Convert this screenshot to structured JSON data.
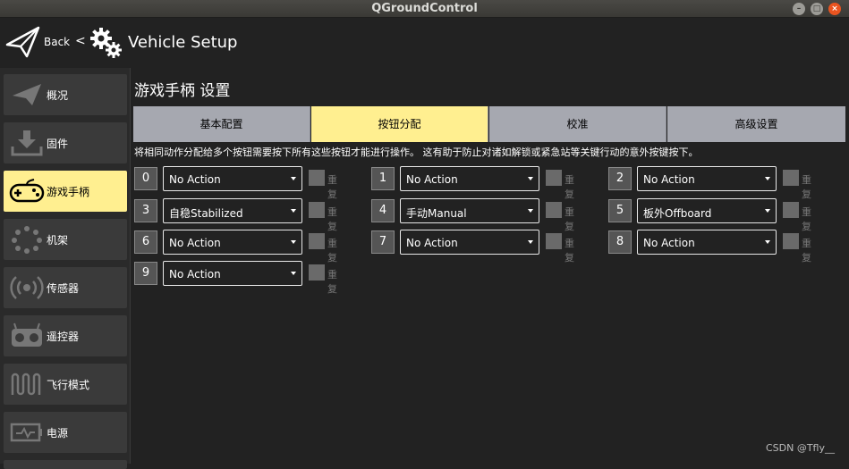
{
  "window": {
    "title": "QGroundControl",
    "min": "–",
    "max": "□",
    "close": "×"
  },
  "header": {
    "back_label": "Back",
    "chevron": "<",
    "title": "Vehicle Setup"
  },
  "sidebar": {
    "items": [
      {
        "label": "概况",
        "icon": "plane-icon"
      },
      {
        "label": "固件",
        "icon": "download-icon"
      },
      {
        "label": "游戏手柄",
        "icon": "gamepad-icon",
        "active": true
      },
      {
        "label": "机架",
        "icon": "dots-circle-icon"
      },
      {
        "label": "传感器",
        "icon": "radio-waves-icon"
      },
      {
        "label": "遥控器",
        "icon": "rc-transmitter-icon"
      },
      {
        "label": "飞行模式",
        "icon": "wave-icon"
      },
      {
        "label": "电源",
        "icon": "battery-icon"
      }
    ]
  },
  "content": {
    "title": "游戏手柄 设置",
    "tabs": [
      "基本配置",
      "按钮分配",
      "校准",
      "高级设置"
    ],
    "active_tab": 1,
    "hint": "将相同动作分配给多个按钮需要按下所有这些按钮才能进行操作。 这有助于防止对诸如解锁或紧急站等关键行动的意外按键按下。",
    "repeat_label": "重复",
    "buttons": [
      {
        "num": "0",
        "action": "No Action"
      },
      {
        "num": "1",
        "action": "No Action"
      },
      {
        "num": "2",
        "action": "No Action"
      },
      {
        "num": "3",
        "action": "自稳Stabilized"
      },
      {
        "num": "4",
        "action": "手动Manual"
      },
      {
        "num": "5",
        "action": "板外Offboard"
      },
      {
        "num": "6",
        "action": "No Action"
      },
      {
        "num": "7",
        "action": "No Action"
      },
      {
        "num": "8",
        "action": "No Action"
      },
      {
        "num": "9",
        "action": "No Action"
      }
    ]
  },
  "watermark": "CSDN @Tfly__",
  "colors": {
    "active": "#ffef90",
    "tab": "#a6a8b0",
    "bg": "#222222"
  }
}
